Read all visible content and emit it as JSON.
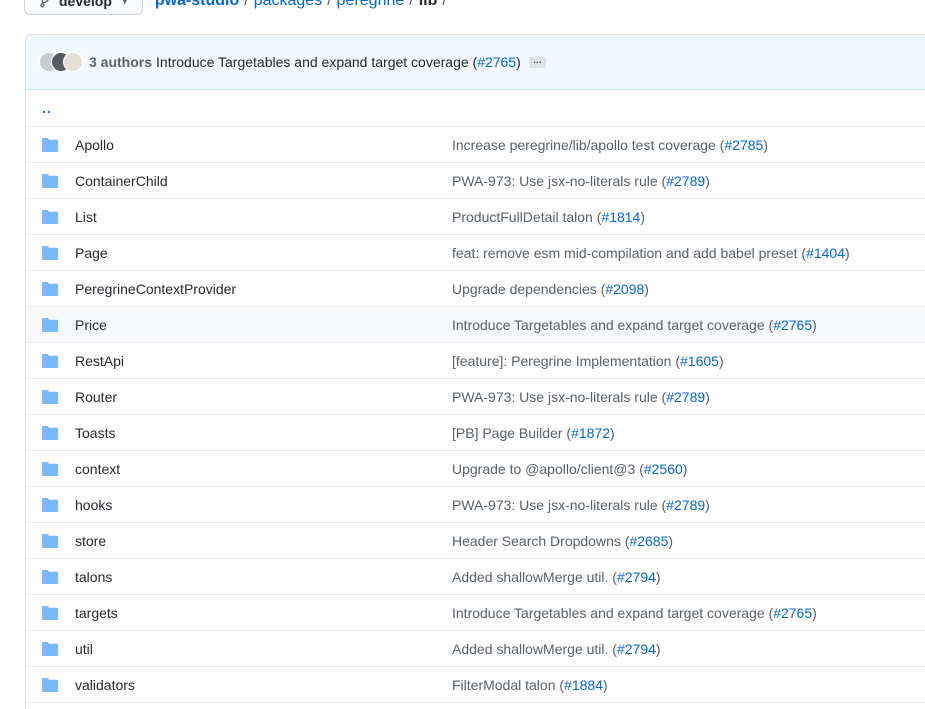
{
  "branch": {
    "label": "develop"
  },
  "breadcrumb": {
    "repo": "pwa-studio",
    "parts": [
      "packages",
      "peregrine"
    ],
    "current": "lib",
    "separator": "/"
  },
  "commit": {
    "authors": "3 authors",
    "message": "Introduce Targetables and expand target coverage (",
    "pr": "#2765",
    "message_end": ")",
    "ellipsis": "…"
  },
  "parent_dir": "..",
  "colors": {
    "accent": "#0366d6",
    "folder": "#79b8ff",
    "header_bg": "#f1f8ff"
  },
  "files": [
    {
      "name": "Apollo",
      "msg": "Increase peregrine/lib/apollo test coverage (",
      "pr": "#2785",
      "end": ")"
    },
    {
      "name": "ContainerChild",
      "msg": "PWA-973: Use jsx-no-literals rule (",
      "pr": "#2789",
      "end": ")"
    },
    {
      "name": "List",
      "msg": "ProductFullDetail talon (",
      "pr": "#1814",
      "end": ")"
    },
    {
      "name": "Page",
      "msg": "feat: remove esm mid-compilation and add babel preset (",
      "pr": "#1404",
      "end": ")"
    },
    {
      "name": "PeregrineContextProvider",
      "msg": "Upgrade dependencies (",
      "pr": "#2098",
      "end": ")"
    },
    {
      "name": "Price",
      "msg": "Introduce Targetables and expand target coverage (",
      "pr": "#2765",
      "end": ")"
    },
    {
      "name": "RestApi",
      "msg": "[feature]: Peregrine Implementation (",
      "pr": "#1605",
      "end": ")"
    },
    {
      "name": "Router",
      "msg": "PWA-973: Use jsx-no-literals rule (",
      "pr": "#2789",
      "end": ")"
    },
    {
      "name": "Toasts",
      "msg": "[PB] Page Builder (",
      "pr": "#1872",
      "end": ")"
    },
    {
      "name": "context",
      "msg": "Upgrade to @apollo/client@3 (",
      "pr": "#2560",
      "end": ")"
    },
    {
      "name": "hooks",
      "msg": "PWA-973: Use jsx-no-literals rule (",
      "pr": "#2789",
      "end": ")"
    },
    {
      "name": "store",
      "msg": "Header Search Dropdowns (",
      "pr": "#2685",
      "end": ")"
    },
    {
      "name": "talons",
      "msg": "Added shallowMerge util. (",
      "pr": "#2794",
      "end": ")"
    },
    {
      "name": "targets",
      "msg": "Introduce Targetables and expand target coverage (",
      "pr": "#2765",
      "end": ")"
    },
    {
      "name": "util",
      "msg": "Added shallowMerge util. (",
      "pr": "#2794",
      "end": ")"
    },
    {
      "name": "validators",
      "msg": "FilterModal talon (",
      "pr": "#1884",
      "end": ")"
    }
  ]
}
